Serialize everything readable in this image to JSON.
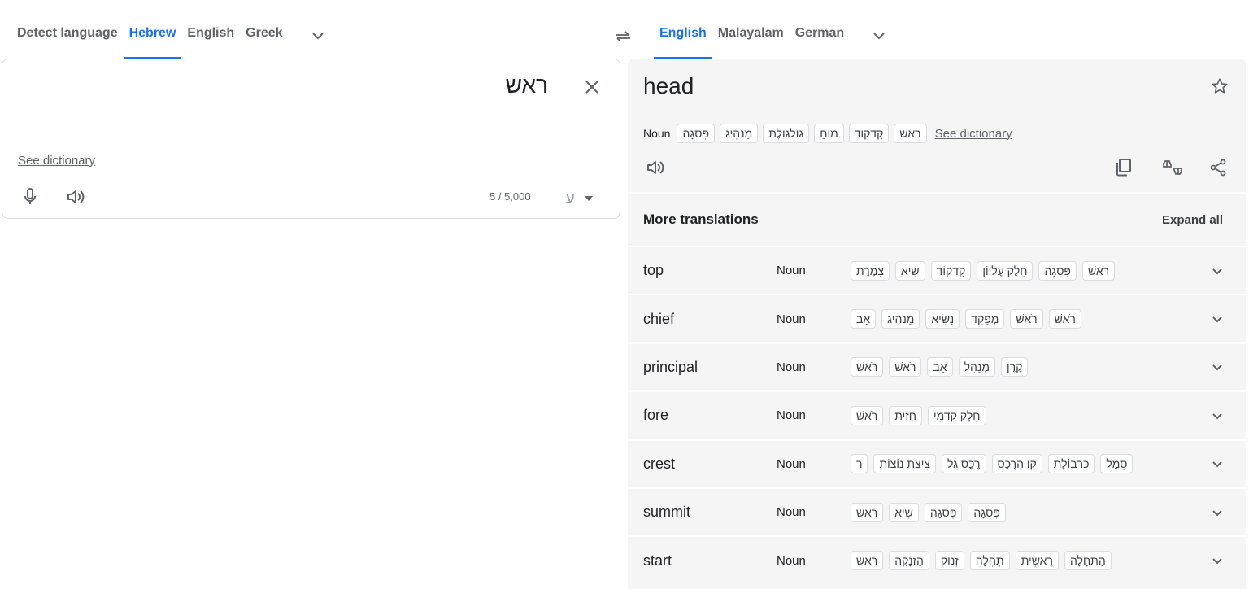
{
  "source_langs": {
    "tabs": [
      "Detect language",
      "Hebrew",
      "English",
      "Greek"
    ],
    "active_index": 1
  },
  "target_langs": {
    "tabs": [
      "English",
      "Malayalam",
      "German"
    ],
    "active_index": 0
  },
  "source": {
    "text": "ראש",
    "dictionary_link": "See dictionary",
    "char_count": "5 / 5,000",
    "keyboard_glyph": "ע"
  },
  "target": {
    "text": "head",
    "alt_pos": "Noun",
    "alternatives": [
      "פִּסגָה",
      "מַנהִיג",
      "גולגולֶת",
      "מוֹחַ",
      "קָדקוֹד",
      "רֹאשׁ"
    ],
    "dictionary_link": "See dictionary"
  },
  "more_translations": {
    "title": "More translations",
    "expand_all": "Expand all",
    "rows": [
      {
        "word": "top",
        "pos": "Noun",
        "chips": [
          "רֹאשׁ",
          "פִּסגָה",
          "חֵלֶק עֶליוֹן",
          "קָדקוֹד",
          "שִׂיא",
          "צַמֶרֶת"
        ]
      },
      {
        "word": "chief",
        "pos": "Noun",
        "chips": [
          "רֹאשׁ",
          "רֹאשׁ",
          "מְפַקֵד",
          "נָשִׂיא",
          "מַנהִיג",
          "אָב"
        ]
      },
      {
        "word": "principal",
        "pos": "Noun",
        "chips": [
          "קֶרֶן",
          "מְנַהֵל",
          "אָב",
          "רֹאשׁ",
          "רֹאשׁ"
        ]
      },
      {
        "word": "fore",
        "pos": "Noun",
        "chips": [
          "חֵלֶק קִדמִי",
          "חָזִית",
          "רֹאשׁ"
        ]
      },
      {
        "word": "crest",
        "pos": "Noun",
        "chips": [
          "סֵמֶל",
          "כַּרבּוֹלֶת",
          "קַו הָרֶכֶס",
          "רֶכֶס גַל",
          "צִיצַת נוֹצוֹת",
          "ר"
        ]
      },
      {
        "word": "summit",
        "pos": "Noun",
        "chips": [
          "פִּסגָה",
          "פִּסגָה",
          "שִׂיא",
          "רֹאשׁ"
        ]
      },
      {
        "word": "start",
        "pos": "Noun",
        "chips": [
          "הַתחָלָה",
          "רֵאשִׁית",
          "תְחִלָה",
          "זִנוּק",
          "הַזנָקָה",
          "רֹאשׁ"
        ]
      }
    ]
  },
  "colors": {
    "accent": "#1a73e8",
    "panel_bg": "#f5f5f5",
    "icon": "#5f6368"
  },
  "icons": {
    "dropdown": "chevron-down-icon",
    "swap": "swap-arrows-icon",
    "clear": "close-icon",
    "mic": "microphone-icon",
    "speaker": "speaker-icon",
    "star": "star-icon",
    "copy": "copy-icon",
    "feedback": "thumbs-feedback-icon",
    "share": "share-icon"
  }
}
